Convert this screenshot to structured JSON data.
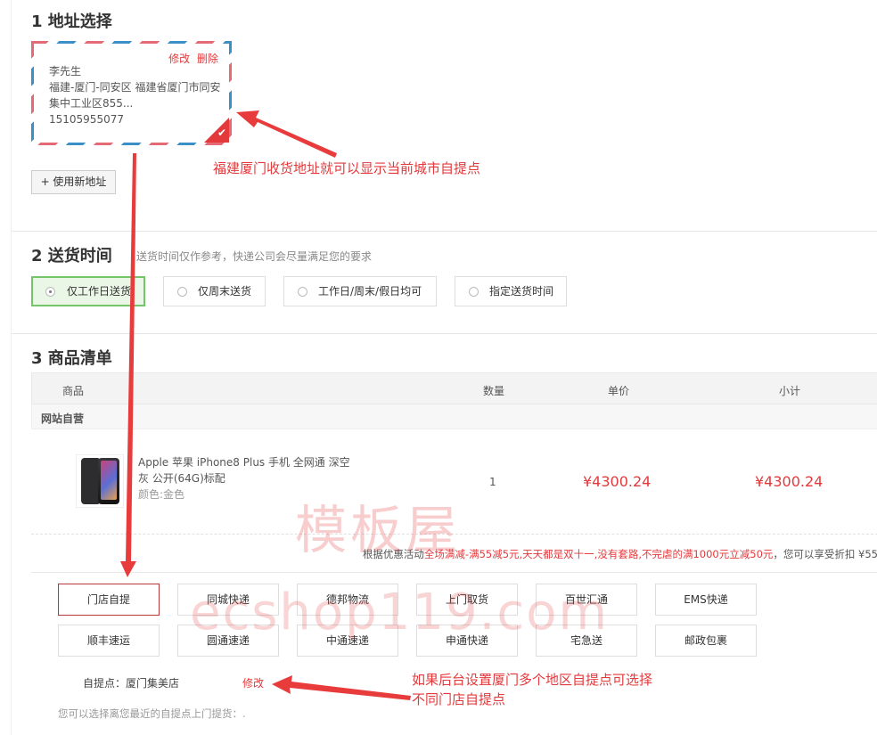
{
  "sections": {
    "address": "1 地址选择",
    "delivery": "2 送货时间",
    "goods": "3 商品清单"
  },
  "address_card": {
    "edit": "修改",
    "delete": "删除",
    "name": "李先生",
    "line1": "福建-厦门-同安区 福建省厦门市同安",
    "line2": "集中工业区855...",
    "phone": "15105955077"
  },
  "new_address_button": "+ 使用新地址",
  "delivery_note": "送货时间仅作参考，快递公司会尽量满足您的要求",
  "delivery_options": [
    "仅工作日送货",
    "仅周末送货",
    "工作日/周末/假日均可",
    "指定送货时间"
  ],
  "table_headers": {
    "product": "商品",
    "qty": "数量",
    "price": "单价",
    "subtotal": "小计"
  },
  "shop_name": "网站自营",
  "product": {
    "name_line1": "Apple 苹果 iPhone8 Plus 手机 全网通 深空",
    "name_line2": "灰 公开(64G)标配",
    "attr": "颜色:金色",
    "qty": "1",
    "price": "¥4300.24",
    "subtotal": "¥4300.24"
  },
  "promo": {
    "prefix": "根据优惠活动",
    "activity": "全场满减-满55减5元,天天都是双十一,没有套路,不完虐的满1000元立减50元",
    "suffix": "，您可以享受折扣 ¥55"
  },
  "shipping_methods": [
    "门店自提",
    "同城快递",
    "德邦物流",
    "上门取货",
    "百世汇通",
    "EMS快递",
    "顺丰速运",
    "圆通速递",
    "中通速递",
    "申通快递",
    "宅急送",
    "邮政包裹"
  ],
  "pickup": {
    "label": "自提点：厦门集美店",
    "edit": "修改",
    "note": "您可以选择离您最近的自提点上门提货：."
  },
  "annotations": {
    "a1": "福建厦门收货地址就可以显示当前城市自提点",
    "a2_line1": "如果后台设置厦门多个地区自提点可选择",
    "a2_line2": "不同门店自提点"
  },
  "watermarks": {
    "w1": "模板屋",
    "w2": "ecshop119.com"
  },
  "colors": {
    "accent": "#e4393c",
    "selected_green": "#74c46a"
  }
}
